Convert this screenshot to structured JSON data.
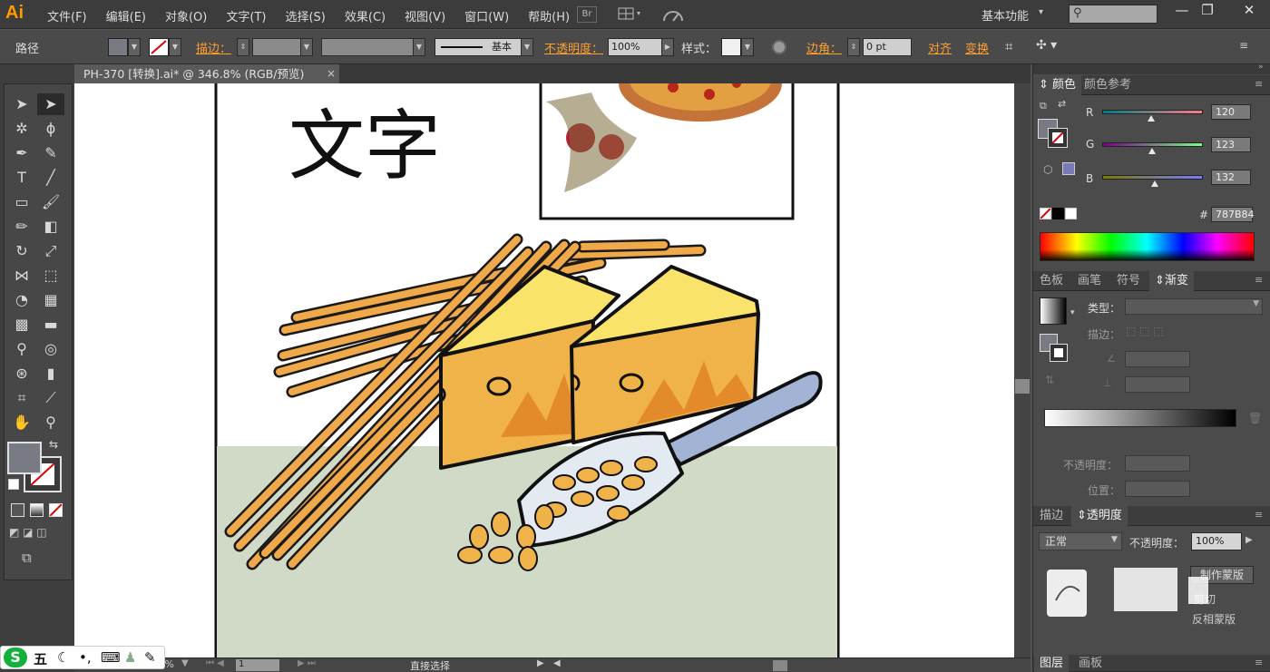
{
  "app": {
    "logo": "Ai"
  },
  "menu": {
    "items": [
      "文件(F)",
      "编辑(E)",
      "对象(O)",
      "文字(T)",
      "选择(S)",
      "效果(C)",
      "视图(V)",
      "窗口(W)",
      "帮助(H)"
    ],
    "br_label": "Br",
    "workspace": "基本功能"
  },
  "control_bar": {
    "object_type": "路径",
    "stroke_label": "描边：",
    "stroke_style": "基本",
    "opacity_label": "不透明度：",
    "opacity_value": "100%",
    "style_label": "样式：",
    "corner_label": "边角：",
    "corner_value": "0 pt",
    "align_label": "对齐",
    "transform_label": "变换"
  },
  "document": {
    "tab_title": "PH-370 [转换].ai* @ 346.8% (RGB/预览)",
    "close_glyph": "×",
    "artwork_text": "文字"
  },
  "status_bar": {
    "zoom": "346.8%",
    "page": "1",
    "tool_name": "直接选择"
  },
  "ime": {
    "chars": [
      "五"
    ]
  },
  "color_panel": {
    "tabs": [
      "颜色",
      "颜色参考"
    ],
    "r_label": "R",
    "r_value": "120",
    "g_label": "G",
    "g_value": "123",
    "b_label": "B",
    "b_value": "132",
    "hex_label": "#",
    "hex_value": "787B84"
  },
  "swatch_panel": {
    "tabs": [
      "色板",
      "画笔",
      "符号",
      "渐变"
    ],
    "type_label": "类型：",
    "stroke_label": "描边：",
    "opacity_label": "不透明度：",
    "location_label": "位置："
  },
  "transparency_panel": {
    "tabs": [
      "描边",
      "透明度"
    ],
    "blend_mode": "正常",
    "opacity_label": "不透明度：",
    "opacity_value": "100%",
    "make_mask": "制作蒙版",
    "clip_label": "剪切",
    "invert_label": "反相蒙版"
  },
  "layers_panel": {
    "tabs": [
      "图层",
      "画板"
    ]
  },
  "colors": {
    "fill": "#787b84",
    "accent_orange": "#ff9f32",
    "canvas_bg": "#ffffff",
    "table_color": "#d0dac6",
    "cheese": "#f0b34a",
    "cheese_top": "#f9e36a",
    "pasta": "#f0a94a"
  }
}
